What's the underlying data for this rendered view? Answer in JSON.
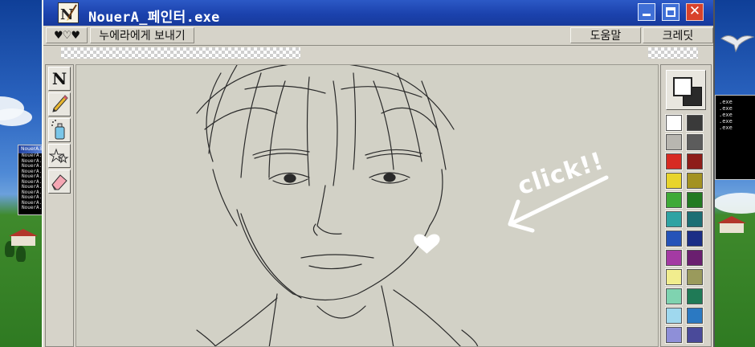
{
  "window": {
    "title": "NouerA_페인터.exe",
    "app_icon": "paint-brush-app-icon",
    "controls": {
      "minimize": "minimize-icon",
      "maximize": "maximize-icon",
      "close": "close-icon"
    },
    "colors": {
      "titlebar": "#1b42ad",
      "close": "#d8422c",
      "chrome": "#d6d3c9"
    }
  },
  "menu": {
    "hearts": "♥♡♥",
    "send": "누에라에게 보내기",
    "help": "도움말",
    "credits": "크레딧"
  },
  "tools": [
    {
      "name": "text-tool",
      "glyph": "N"
    },
    {
      "name": "pencil-tool",
      "icon": "pencil-icon"
    },
    {
      "name": "spray-tool",
      "icon": "spray-can-icon"
    },
    {
      "name": "star-tool",
      "icon": "star-shapes-icon"
    },
    {
      "name": "eraser-tool",
      "icon": "eraser-icon"
    }
  ],
  "canvas": {
    "annotation": "click!!",
    "content": "pencil sketch of a person's face",
    "icons": [
      "arrow-icon",
      "heart-icon"
    ]
  },
  "palette": {
    "foreground": "#ffffff",
    "background": "#2a2a2a",
    "colors": [
      [
        "#ffffff",
        "#3a3a3a"
      ],
      [
        "#b8b6b0",
        "#5c5c5c"
      ],
      [
        "#d72b22",
        "#8e1d19"
      ],
      [
        "#e8d42b",
        "#a39222"
      ],
      [
        "#3faa37",
        "#227a22"
      ],
      [
        "#2fa3a3",
        "#1c6e74"
      ],
      [
        "#2553b8",
        "#1b2e86"
      ],
      [
        "#a43aa3",
        "#6a1f6f"
      ],
      [
        "#f1ed8e",
        "#9a9a5c"
      ],
      [
        "#7fd3b0",
        "#1f7a56"
      ],
      [
        "#9fd8ee",
        "#2b79c2"
      ],
      [
        "#8e8fd8",
        "#4a4a9a"
      ]
    ]
  },
  "background_windows": {
    "left_title": "NouerA.E",
    "left_lines": [
      "NouerA.exe",
      "NouerA.exe",
      "NouerA.exe",
      "NouerA.exe",
      "NouerA.exe",
      "NouerA.exe",
      "NouerA.exe",
      "NouerA.exe",
      "NouerA.exe",
      "NouerA.exe",
      "NouerA.exe"
    ],
    "right_lines": [
      ".exe",
      ".exe",
      ".exe",
      ".exe",
      ".exe"
    ]
  }
}
